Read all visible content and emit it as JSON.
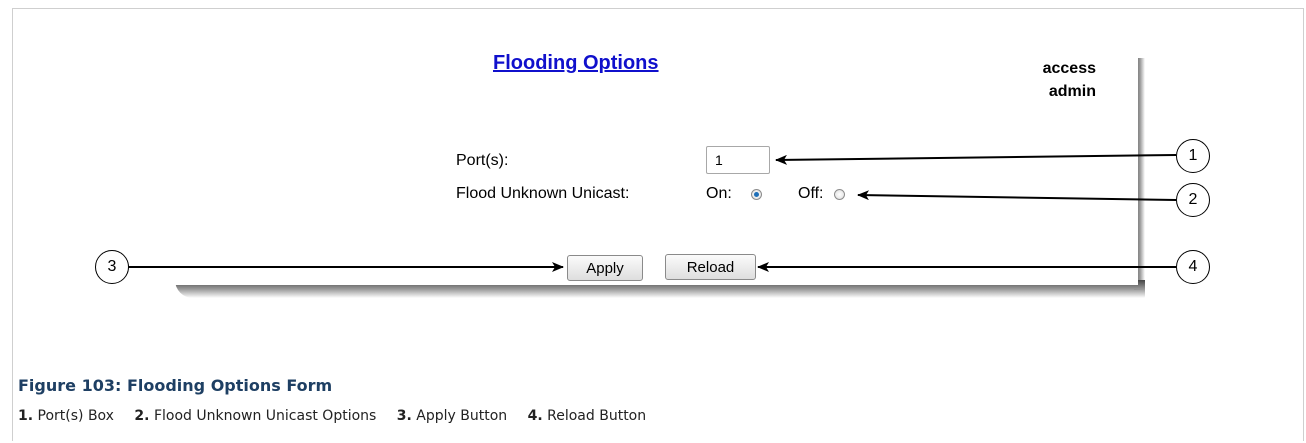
{
  "form": {
    "title": "Flooding Options",
    "user_line1": "access",
    "user_line2": "admin",
    "port_label": "Port(s):",
    "port_value": "1",
    "flood_label": "Flood Unknown Unicast:",
    "on_label": "On:",
    "off_label": "Off:",
    "flood_selected": "On",
    "apply_label": "Apply",
    "reload_label": "Reload"
  },
  "callouts": [
    "1",
    "2",
    "3",
    "4"
  ],
  "caption": "Figure 103: Flooding Options Form",
  "legend": [
    {
      "num": "1.",
      "text": "Port(s) Box"
    },
    {
      "num": "2.",
      "text": "Flood Unknown Unicast Options"
    },
    {
      "num": "3.",
      "text": "Apply Button"
    },
    {
      "num": "4.",
      "text": "Reload Button"
    }
  ],
  "colors": {
    "title_link": "#1010cc",
    "caption": "#1e3f63",
    "radio_selected": "#1e6fb8"
  }
}
